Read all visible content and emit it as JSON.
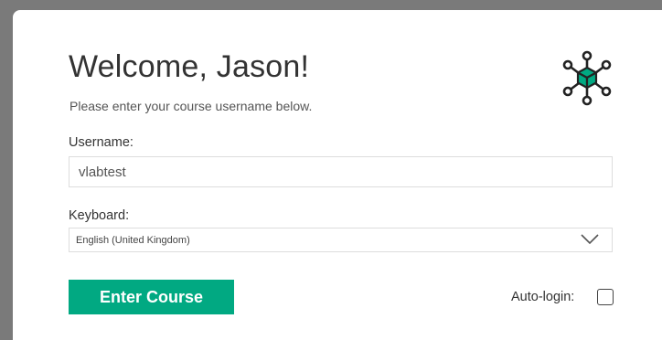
{
  "welcome": {
    "title": "Welcome, Jason!",
    "subtitle": "Please enter your course username below."
  },
  "username": {
    "label": "Username:",
    "value": "vlabtest"
  },
  "keyboard": {
    "label": "Keyboard:",
    "selected": "English (United Kingdom)"
  },
  "actions": {
    "enter_label": "Enter Course",
    "autologin_label": "Auto-login:",
    "autologin_checked": false
  },
  "icons": {
    "logo": "network-cube-icon",
    "select_arrow": "chevron-down-icon"
  },
  "colors": {
    "accent": "#01a982",
    "backdrop": "#7a7a7a",
    "card": "#ffffff"
  }
}
